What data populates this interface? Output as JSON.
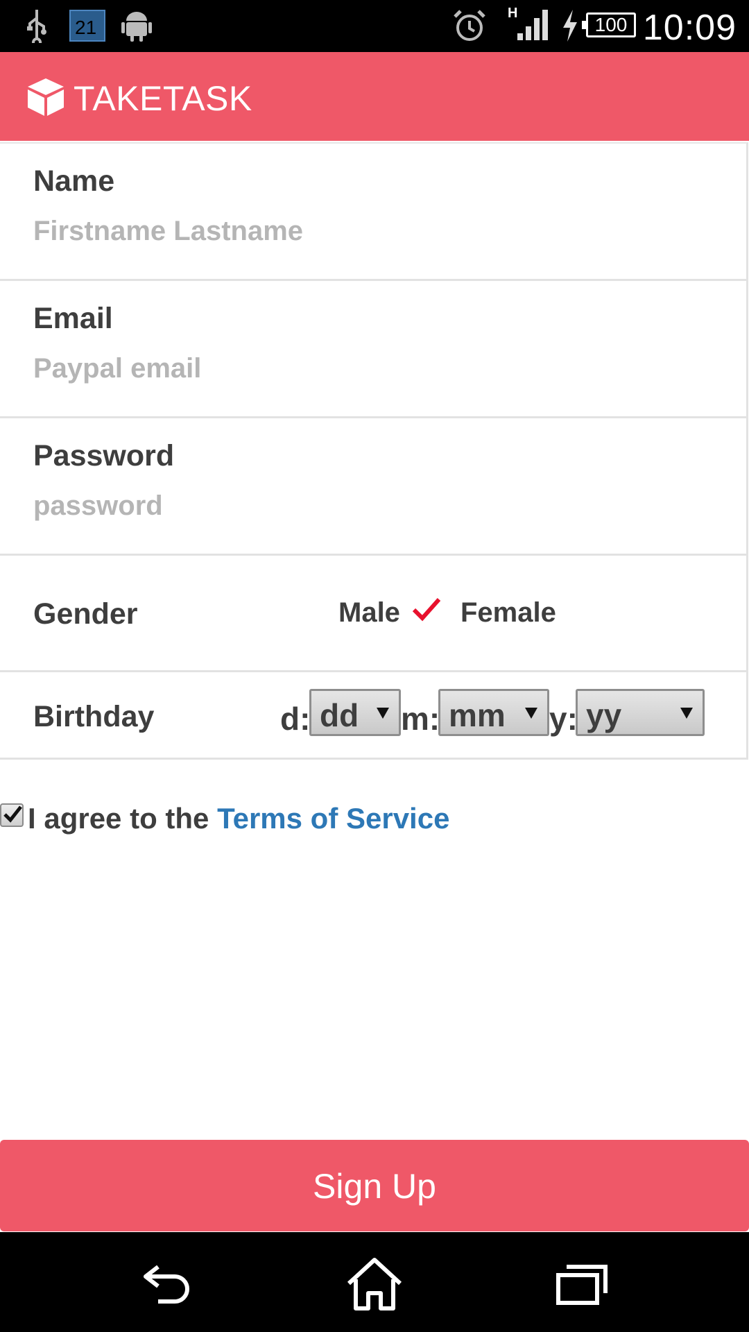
{
  "status_bar": {
    "calendar_day": "21",
    "network": "H",
    "battery": "100",
    "time": "10:09",
    "icons": [
      "usb-icon",
      "calendar-icon",
      "android-icon",
      "alarm-icon",
      "signal-icon",
      "charging-icon",
      "battery-icon"
    ]
  },
  "app_bar": {
    "title": "TAKETASK",
    "logo_icon": "cube-icon",
    "color": "#ef5868"
  },
  "form": {
    "name": {
      "label": "Name",
      "placeholder": "Firstname Lastname",
      "value": ""
    },
    "email": {
      "label": "Email",
      "placeholder": "Paypal email",
      "value": ""
    },
    "password": {
      "label": "Password",
      "placeholder": "password",
      "value": ""
    },
    "gender": {
      "label": "Gender",
      "options": [
        "Male",
        "Female"
      ],
      "selected": "Male",
      "check_color": "#e8112d"
    },
    "birthday": {
      "label": "Birthday",
      "day_prefix": "d:",
      "day_value": "dd",
      "month_prefix": "m:",
      "month_value": "mm",
      "year_prefix": "y:",
      "year_value": "yy"
    }
  },
  "terms": {
    "checked": true,
    "text": "I agree to the ",
    "link": "Terms of Service",
    "link_color": "#2d78b6"
  },
  "signup": {
    "label": "Sign Up"
  },
  "nav_bar": {
    "icons": [
      "back-icon",
      "home-icon",
      "recent-apps-icon"
    ]
  }
}
